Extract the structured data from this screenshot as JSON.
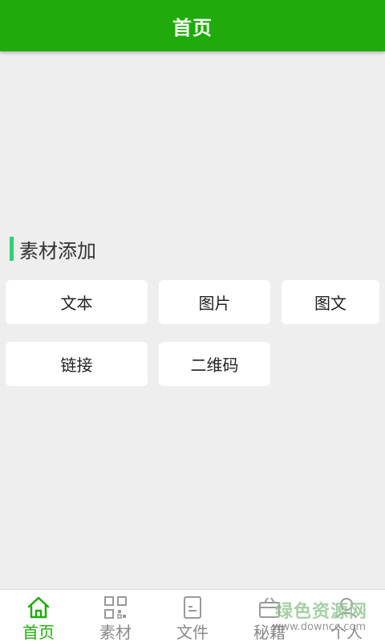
{
  "header": {
    "title": "首页"
  },
  "section": {
    "title": "素材添加"
  },
  "buttons": {
    "text": "文本",
    "image": "图片",
    "image_text": "图文",
    "link": "链接",
    "qrcode": "二维码"
  },
  "tabs": [
    {
      "label": "首页",
      "icon": "home-icon",
      "active": true
    },
    {
      "label": "素材",
      "icon": "qr-grid-icon",
      "active": false
    },
    {
      "label": "文件",
      "icon": "document-icon",
      "active": false
    },
    {
      "label": "秘籍",
      "icon": "gift-box-icon",
      "active": false
    },
    {
      "label": "个人",
      "icon": "user-icon",
      "active": false
    }
  ],
  "watermark": {
    "cn": "绿色资源网",
    "en": "www.downcc.com"
  },
  "colors": {
    "primary": "#1fab0a",
    "accent_bar": "#2ed175",
    "background": "#eeeeee",
    "tab_inactive": "#888888"
  }
}
